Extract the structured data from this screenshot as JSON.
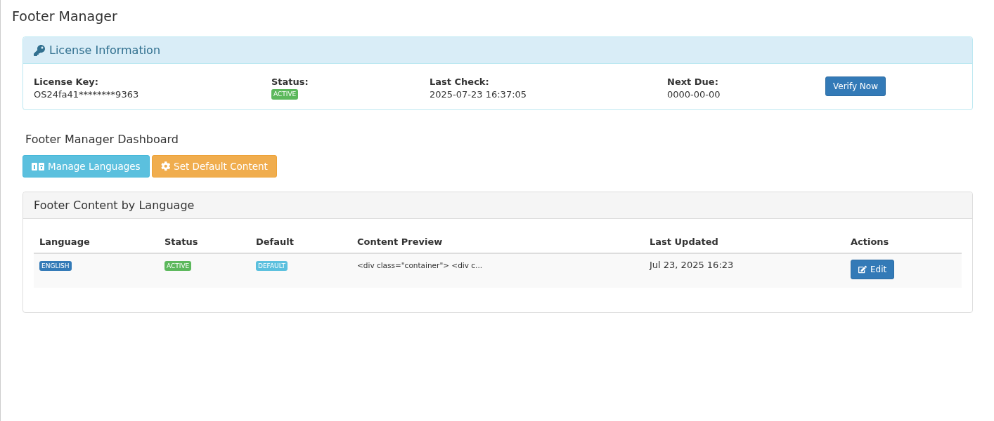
{
  "page_title": "Footer Manager",
  "license": {
    "title": "License Information",
    "fields": [
      {
        "kind": "text",
        "label": "License Key:",
        "value": "OS24fa41********9363"
      },
      {
        "kind": "badge",
        "label": "Status:",
        "value": "ACTIVE"
      },
      {
        "kind": "text",
        "label": "Last Check:",
        "value": "2025-07-23 16:37:05"
      },
      {
        "kind": "text",
        "label": "Next Due:",
        "value": "0000-00-00"
      }
    ],
    "verify_button": "Verify Now"
  },
  "dashboard": {
    "title": "Footer Manager Dashboard",
    "buttons": [
      {
        "kind": "languages",
        "label": "Manage Languages"
      },
      {
        "kind": "settings",
        "label": "Set Default Content"
      }
    ]
  },
  "content_panel": {
    "title": "Footer Content by Language",
    "columns": [
      "Language",
      "Status",
      "Default",
      "Content Preview",
      "Last Updated",
      "Actions"
    ],
    "rows": [
      {
        "language": "ENGLISH",
        "status": "ACTIVE",
        "default": "DEFAULT",
        "preview": "<div class=\"container\"> <div c...",
        "last_updated": "Jul 23, 2025 16:23",
        "action": "Edit"
      }
    ]
  }
}
